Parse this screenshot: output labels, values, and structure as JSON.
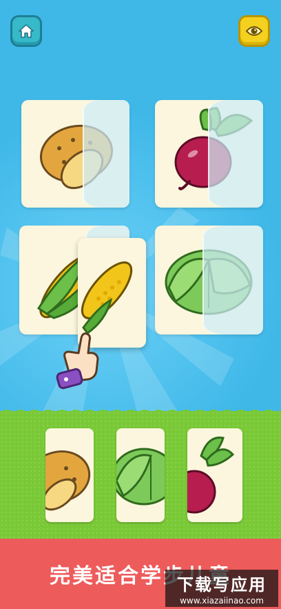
{
  "header": {
    "home_icon": "home-icon",
    "eye_icon": "eye-icon"
  },
  "board": {
    "cards": [
      {
        "item": "potato",
        "icon": "potato-icon"
      },
      {
        "item": "beetroot",
        "icon": "beetroot-icon"
      },
      {
        "item": "corn",
        "icon": "corn-icon"
      },
      {
        "item": "cabbage",
        "icon": "cabbage-icon"
      }
    ],
    "hand_hint_icon": "pointing-hand-icon"
  },
  "tray": {
    "pieces": [
      {
        "item": "potato",
        "icon": "potato-half-icon"
      },
      {
        "item": "cabbage",
        "icon": "cabbage-half-icon"
      },
      {
        "item": "beetroot",
        "icon": "beetroot-half-icon"
      }
    ]
  },
  "banner": {
    "text": "完美适合学步儿童"
  },
  "watermark": {
    "title": "下载写应用",
    "url": "www.xiazaiinao.com"
  },
  "colors": {
    "sky": "#3fb8e8",
    "grass": "#79c936",
    "banner": "#ee5b5b",
    "card": "#fbf6dd",
    "home_button": "#36b9c9",
    "eye_button": "#f3d11e"
  }
}
